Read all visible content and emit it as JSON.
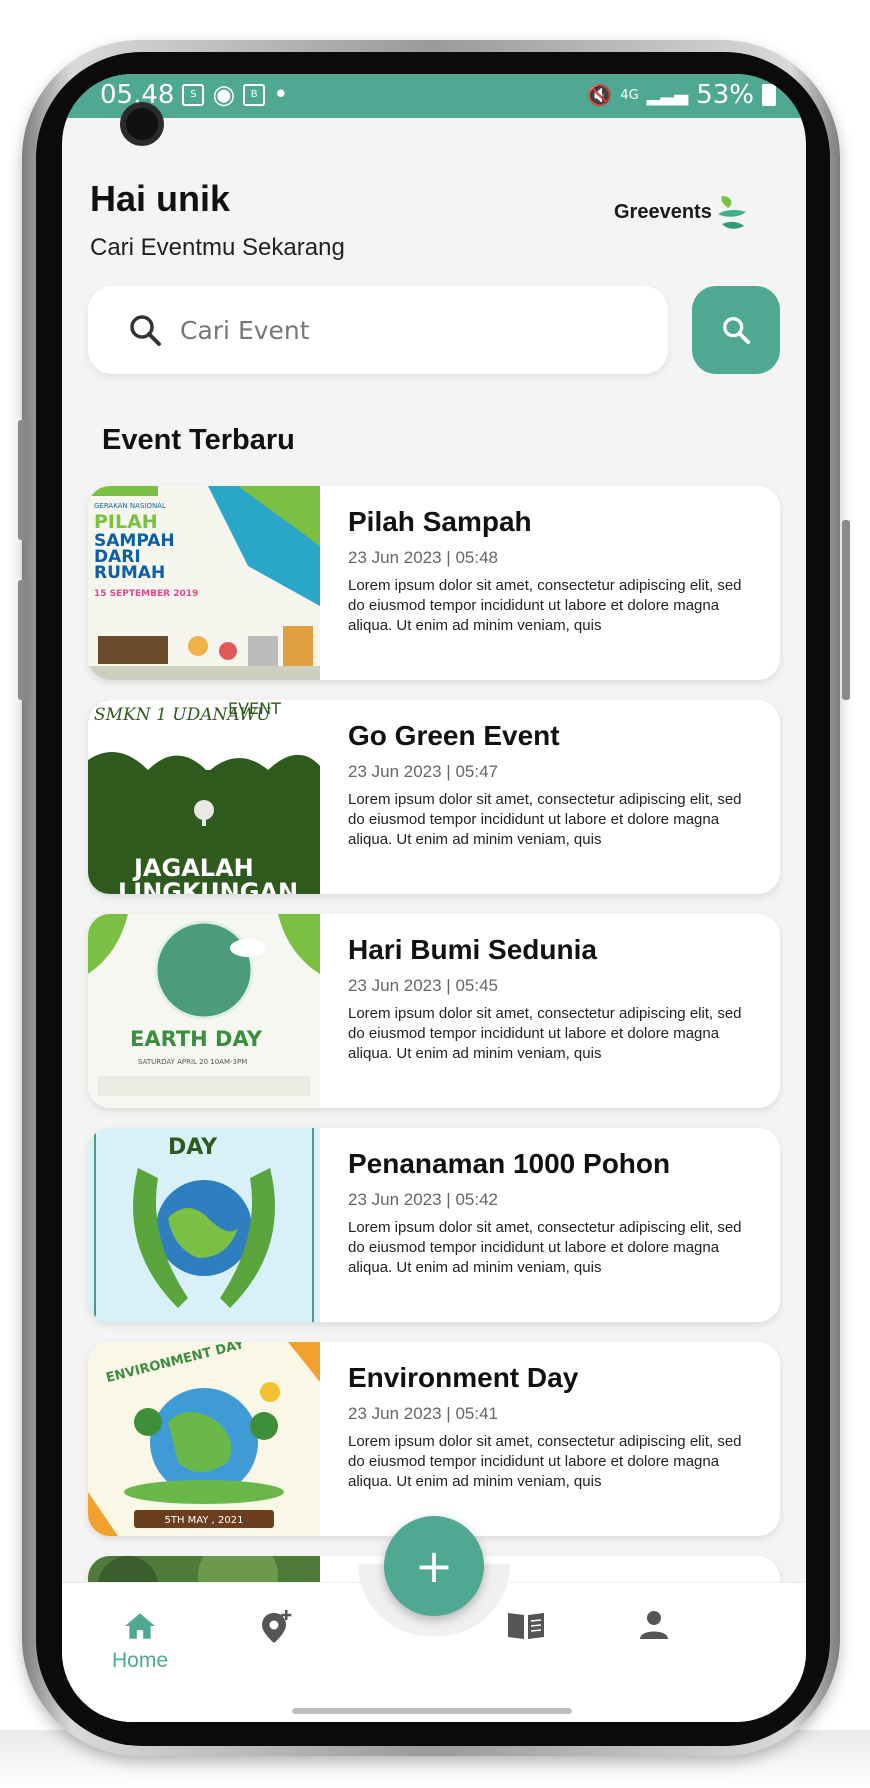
{
  "status_bar": {
    "time": "05.48",
    "network": "4G",
    "battery": "53%"
  },
  "header": {
    "greeting": "Hai unik",
    "subtitle": "Cari Eventmu Sekarang",
    "logo_text": "Greevents"
  },
  "search": {
    "placeholder": "Cari Event"
  },
  "section": {
    "title": "Event Terbaru"
  },
  "events": [
    {
      "title": "Pilah Sampah",
      "date": "23 Jun 2023 | 05:48",
      "description": "Lorem ipsum dolor sit amet, consectetur adipiscing elit, sed do eiusmod tempor incididunt ut labore et dolore magna aliqua. Ut enim ad minim veniam, quis",
      "thumb_text": [
        "GERAKAN NASIONAL",
        "PILAH",
        "SAMPAH",
        "DARI",
        "RUMAH",
        "15 SEPTEMBER 2019"
      ]
    },
    {
      "title": "Go Green Event",
      "date": "23 Jun 2023 | 05:47",
      "description": "Lorem ipsum dolor sit amet, consectetur adipiscing elit, sed do eiusmod tempor incididunt ut labore et dolore magna aliqua. Ut enim ad minim veniam, quis",
      "thumb_text": [
        "SMKN 1 UDANAWU",
        "EVENT",
        "JAGALAH",
        "LINGKUNGAN"
      ]
    },
    {
      "title": "Hari Bumi Sedunia",
      "date": "23 Jun 2023 | 05:45",
      "description": "Lorem ipsum dolor sit amet, consectetur adipiscing elit, sed do eiusmod tempor incididunt ut labore et dolore magna aliqua. Ut enim ad minim veniam, quis",
      "thumb_text": [
        "EARTH DAY",
        "SATURDAY  APRIL 20  10AM-3PM"
      ]
    },
    {
      "title": "Penanaman 1000 Pohon",
      "date": "23 Jun 2023 | 05:42",
      "description": "Lorem ipsum dolor sit amet, consectetur adipiscing elit, sed do eiusmod tempor incididunt ut labore et dolore magna aliqua. Ut enim ad minim veniam, quis",
      "thumb_text": [
        "DAY"
      ]
    },
    {
      "title": "Environment Day",
      "date": "23 Jun 2023 | 05:41",
      "description": "Lorem ipsum dolor sit amet, consectetur adipiscing elit, sed do eiusmod tempor incididunt ut labore et dolore magna aliqua. Ut enim ad minim veniam, quis",
      "thumb_text": [
        "ENVIRONMENT DAY",
        "5TH MAY , 2021"
      ]
    }
  ],
  "bottom_nav": {
    "home_label": "Home",
    "fab_symbol": "+",
    "active_color": "#4ea892",
    "icons": [
      "home-icon",
      "add-location-icon",
      "book-icon",
      "person-icon"
    ]
  },
  "theme": {
    "accent": "#4ea892"
  }
}
